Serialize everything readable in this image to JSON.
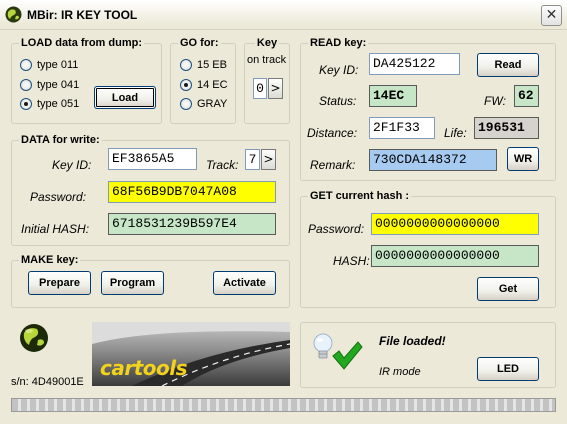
{
  "window": {
    "title": "MBir: IR KEY TOOL",
    "close_glyph": "✕"
  },
  "load_group": {
    "title": "LOAD data from dump:",
    "options": [
      "type 011",
      "type 041",
      "type 051"
    ],
    "selected": "type 051",
    "load_label": "Load"
  },
  "go_group": {
    "title": "GO for:",
    "options": [
      "15 EB",
      "14 EC",
      "GRAY"
    ],
    "selected": "14 EC"
  },
  "key_group": {
    "title": "Key",
    "subtitle": "on track",
    "value": "0",
    "next_label": ">"
  },
  "read_group": {
    "title": "READ key:",
    "key_id_label": "Key ID:",
    "key_id": "DA425122",
    "read_label": "Read",
    "status_label": "Status:",
    "status": "14EC",
    "fw_label": "FW:",
    "fw": "62",
    "distance_label": "Distance:",
    "distance": "2F1F33",
    "life_label": "Life:",
    "life": "196531",
    "remark_label": "Remark:",
    "remark": "730CDA148372",
    "wr_label": "WR"
  },
  "write_group": {
    "title": "DATA for write:",
    "key_id_label": "Key ID:",
    "key_id": "EF3865A5",
    "track_label": "Track:",
    "track": "7",
    "track_next": ">",
    "password_label": "Password:",
    "password": "68F56B9DB7047A08",
    "hash_label": "Initial HASH:",
    "hash": "6718531239B597E4"
  },
  "hash_group": {
    "title": "GET current hash :",
    "password_label": "Password:",
    "password": "0000000000000000",
    "hash_label": "HASH:",
    "hash": "0000000000000000",
    "get_label": "Get"
  },
  "make_group": {
    "title": "MAKE key:",
    "prepare_label": "Prepare",
    "program_label": "Program",
    "activate_label": "Activate"
  },
  "status_panel": {
    "message": "File loaded!",
    "mode": "IR mode",
    "led_label": "LED"
  },
  "footer": {
    "serial": "s/n: 4D49001E",
    "brand": "cartools"
  },
  "colors": {
    "yellow_field": "#ffff00",
    "green_field": "#c6e6c7",
    "blue_field": "#a6caf0",
    "check": "#22a81e"
  }
}
